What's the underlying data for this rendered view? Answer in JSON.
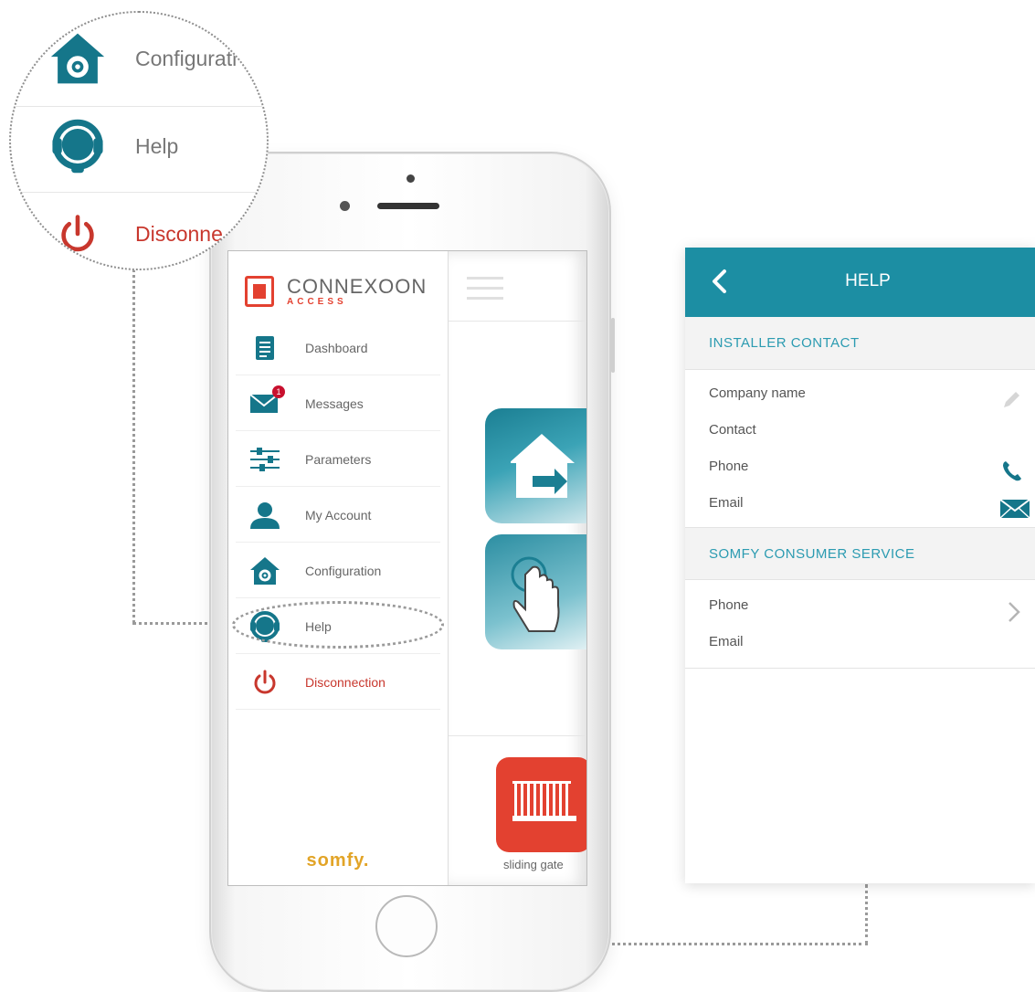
{
  "bubble": {
    "items": [
      {
        "label": "Configurati",
        "icon": "house-gear-icon"
      },
      {
        "label": "Help",
        "icon": "headset-icon"
      },
      {
        "label": "Disconne",
        "icon": "power-icon"
      }
    ]
  },
  "menu": {
    "logo": {
      "name": "CONNEXOON",
      "sub": "ACCESS"
    },
    "items": [
      {
        "label": "Dashboard",
        "icon": "dashboard-icon"
      },
      {
        "label": "Messages",
        "icon": "envelope-icon",
        "badge": "1"
      },
      {
        "label": "Parameters",
        "icon": "sliders-icon"
      },
      {
        "label": "My Account",
        "icon": "user-icon"
      },
      {
        "label": "Configuration",
        "icon": "house-gear-icon"
      },
      {
        "label": "Help",
        "icon": "headset-icon"
      },
      {
        "label": "Disconnection",
        "icon": "power-icon"
      }
    ],
    "brand": "somfy."
  },
  "right_pane": {
    "tile_label": "sliding gate"
  },
  "help": {
    "title": "HELP",
    "installer_section": "INSTALLER CONTACT",
    "installer_fields": [
      "Company name",
      "Contact",
      "Phone",
      "Email"
    ],
    "consumer_section": "SOMFY CONSUMER SERVICE",
    "consumer_fields": [
      "Phone",
      "Email"
    ]
  },
  "colors": {
    "teal": "#1c8ea3",
    "red": "#c8372d",
    "somfy_yellow": "#e2a427"
  }
}
